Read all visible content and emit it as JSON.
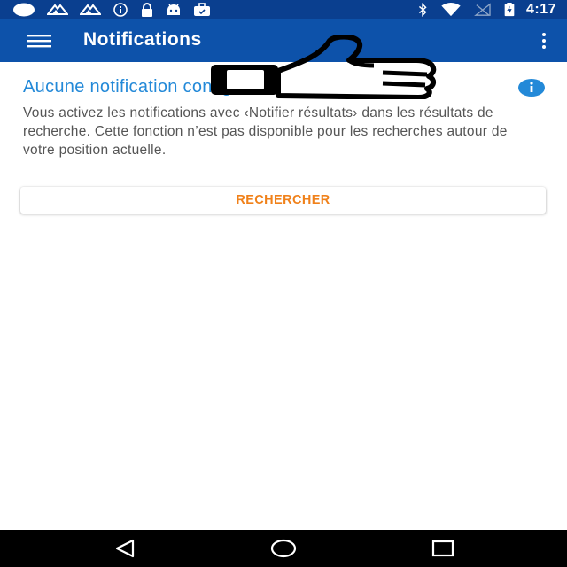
{
  "status_bar": {
    "time": "4:17",
    "left_icons": [
      "circle-icon",
      "signal-icon",
      "signal-icon",
      "info-icon",
      "lock-icon",
      "android-icon",
      "briefcase-icon"
    ],
    "right_icons": [
      "bluetooth-icon",
      "wifi-icon",
      "no-signal-icon",
      "battery-charging-icon"
    ]
  },
  "app_bar": {
    "title": "Notifications",
    "menu_icon": "menu-icon",
    "overflow_icon": "more-vert-icon"
  },
  "content": {
    "empty_title": "Aucune notification configurée",
    "description": "Vous activez les notifications avec ‹Notifier résultats› dans les résultats de recherche. Cette fonction n’est pas disponible pour les recherches autour de votre position actuelle.",
    "search_button_label": "RECHERCHER",
    "info_icon": "info-icon"
  },
  "overlay": {
    "icon": "thumbs-up-icon"
  },
  "nav_bar": {
    "buttons": [
      "back-icon",
      "home-icon",
      "recents-icon"
    ]
  },
  "colors": {
    "status_bar": "#0a3f8f",
    "app_bar": "#0d52aa",
    "title_blue": "#2389d8",
    "button_orange": "#f0811a",
    "nav_bar": "#000000"
  }
}
